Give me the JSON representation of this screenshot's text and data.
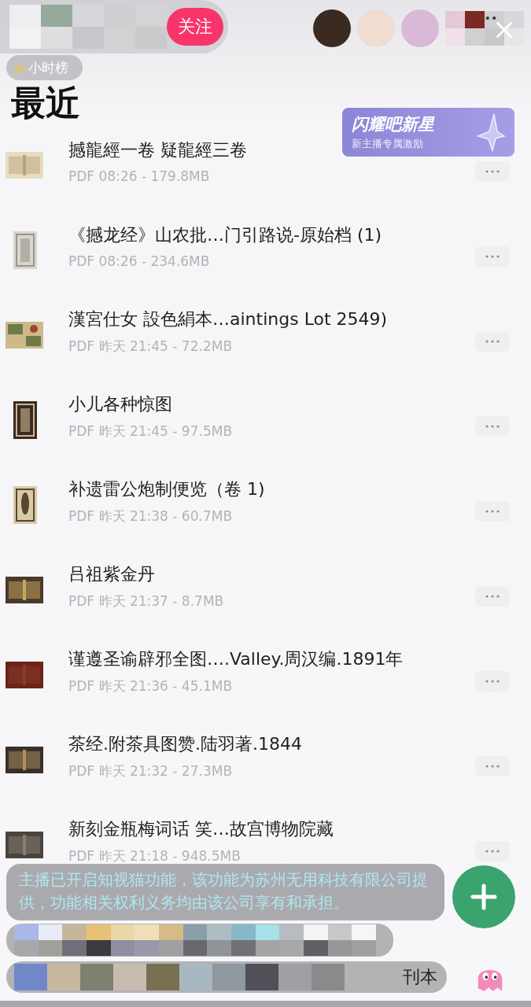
{
  "stream_bar": {
    "follow_button": "关注",
    "rank_badge": "小时榜"
  },
  "banner": {
    "title": "闪耀吧新星",
    "subtitle": "新主播专属激励"
  },
  "page_title": "最近",
  "files": [
    {
      "title": "撼龍經一卷 疑龍經三卷",
      "meta": "PDF 08:26 - 179.8MB"
    },
    {
      "title": "《撼龙经》山农批…门引路说-原始档 (1)",
      "meta": "PDF 08:26 - 234.6MB"
    },
    {
      "title": "漢宮仕女 設色絹本…aintings  Lot 2549)",
      "meta": "PDF 昨天 21:45 - 72.2MB"
    },
    {
      "title": "小儿各种惊图",
      "meta": "PDF 昨天 21:45 - 97.5MB"
    },
    {
      "title": "补遗雷公炮制便览（卷 1)",
      "meta": "PDF 昨天 21:38 - 60.7MB"
    },
    {
      "title": "吕祖紫金丹",
      "meta": "PDF 昨天 21:37 - 8.7MB"
    },
    {
      "title": "谨遵圣谕辟邪全图….Valley.周汉编.1891年",
      "meta": "PDF 昨天 21:36 - 45.1MB"
    },
    {
      "title": "茶经.附茶具图赞.陆羽著.1844",
      "meta": "PDF 昨天 21:32 - 27.3MB"
    },
    {
      "title": "新刻金瓶梅词话 笑…故宫博物院藏",
      "meta": "PDF 昨天 21:18 - 948.5MB"
    }
  ],
  "notice": "主播已开启知视猫功能，该功能为苏州无用科技有限公司提供，功能相关权利义务均由该公司享有和承担。",
  "partial_row_text": "刊本"
}
